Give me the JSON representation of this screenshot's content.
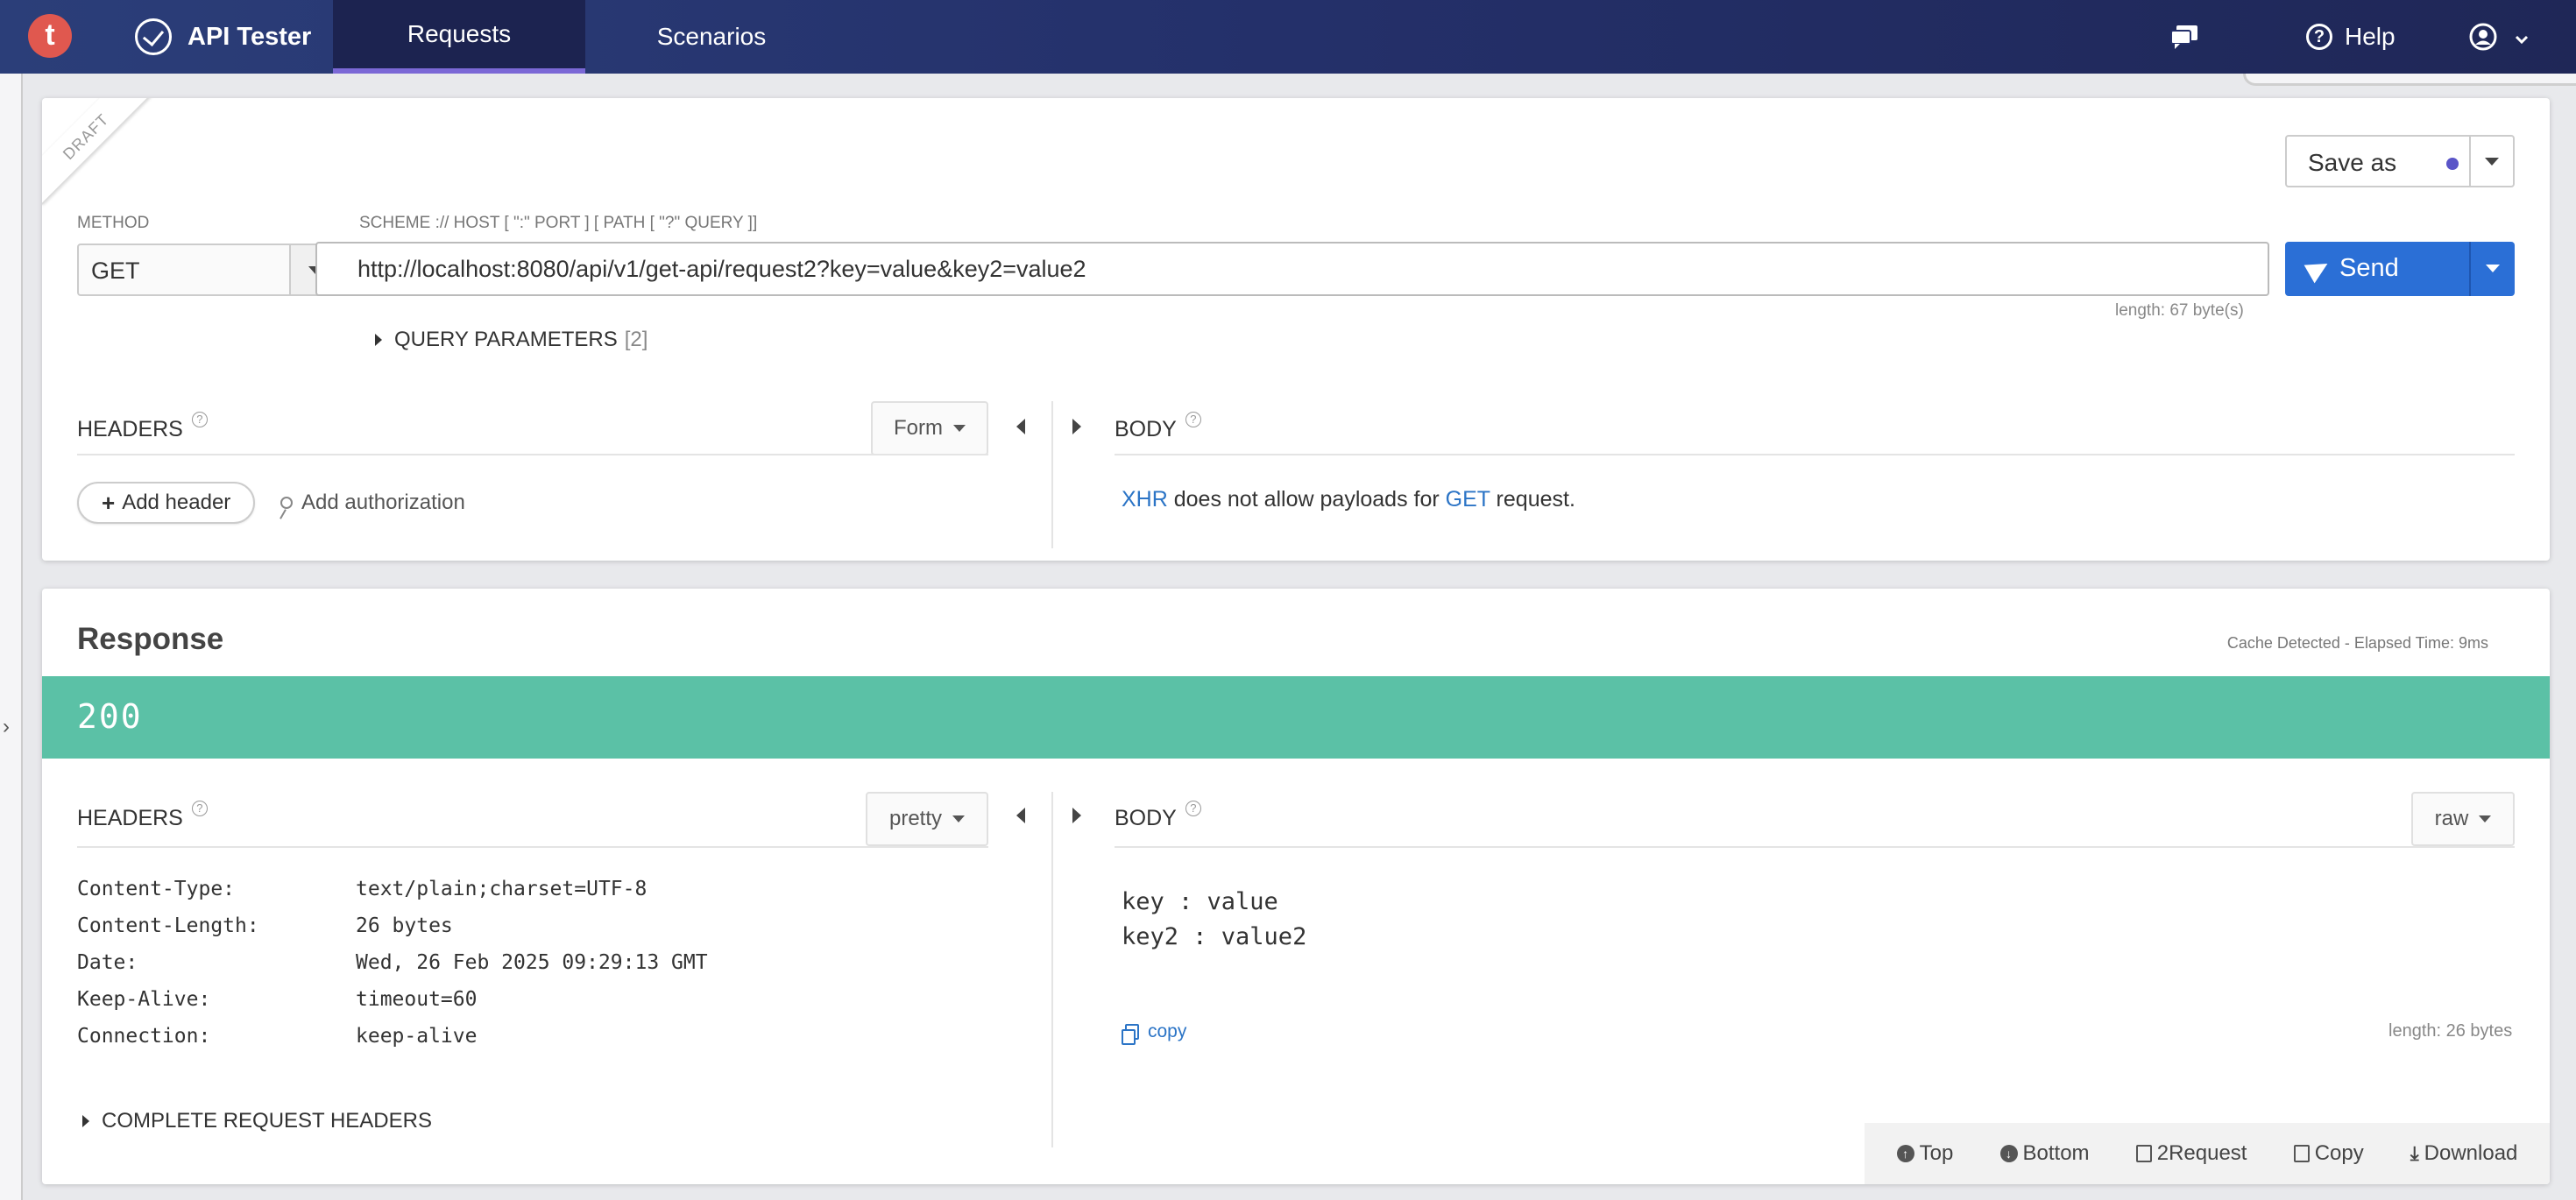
{
  "navbar": {
    "logo_letter": "t",
    "app_name": "API Tester",
    "tabs": [
      {
        "label": "Requests",
        "active": true
      },
      {
        "label": "Scenarios",
        "active": false
      }
    ],
    "help_label": "Help",
    "accent_color": "#7b68d6",
    "icons": [
      "chat-icon",
      "help-icon",
      "user-icon",
      "chevron-down-icon"
    ]
  },
  "request": {
    "draft_label": "DRAFT",
    "method_label": "METHOD",
    "method_value": "GET",
    "url_label": "SCHEME :// HOST [ \":\" PORT ] [ PATH [ \"?\" QUERY ]]",
    "url_value": "http://localhost:8080/api/v1/get-api/request2?key=value&key2=value2",
    "url_length": "length: 67 byte(s)",
    "save_as_label": "Save as",
    "send_label": "Send",
    "query_params_label": "QUERY PARAMETERS",
    "query_params_count": "[2]",
    "headers_label": "HEADERS",
    "headers_mode": "Form",
    "body_label": "BODY",
    "add_header_label": "Add header",
    "add_authorization_label": "Add authorization",
    "body_message": {
      "part1": "XHR",
      "part2": " does not allow payloads for ",
      "part3": "GET",
      "part4": " request."
    }
  },
  "response": {
    "title": "Response",
    "cache_note": "Cache Detected -  Elapsed Time: 9ms",
    "status_code": "200",
    "status_color": "#5bc1a6",
    "headers_label": "HEADERS",
    "headers_mode": "pretty",
    "body_label": "BODY",
    "body_mode": "raw",
    "headers": [
      {
        "key": "Content-Type:",
        "value": "text/plain;charset=UTF-8"
      },
      {
        "key": "Content-Length:",
        "value": "26 bytes"
      },
      {
        "key": "Date:",
        "value": "Wed, 26 Feb 2025 09:29:13 GMT"
      },
      {
        "key": "Keep-Alive:",
        "value": "timeout=60"
      },
      {
        "key": "Connection:",
        "value": "keep-alive"
      }
    ],
    "body_lines": [
      "key : value",
      "key2 : value2"
    ],
    "copy_label": "copy",
    "body_length": "length: 26 bytes",
    "complete_request_headers_label": "COMPLETE REQUEST HEADERS",
    "bottom_bar": {
      "top": "Top",
      "bottom": "Bottom",
      "to_request": "2Request",
      "copy": "Copy",
      "download": "Download"
    }
  }
}
